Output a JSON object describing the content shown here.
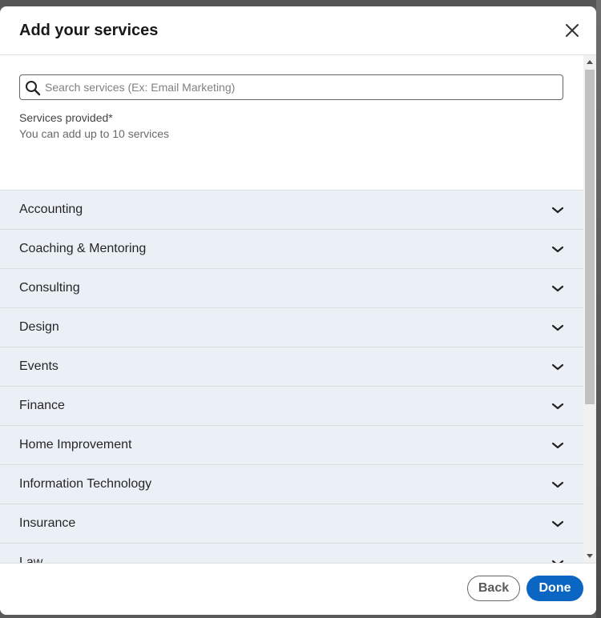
{
  "modal": {
    "title": "Add your services",
    "close_icon": "close-icon"
  },
  "search": {
    "placeholder": "Search services (Ex: Email Marketing)",
    "value": "",
    "icon": "search-icon"
  },
  "services": {
    "label": "Services provided*",
    "hint": "You can add up to 10 services"
  },
  "categories": [
    {
      "label": "Accounting"
    },
    {
      "label": "Coaching & Mentoring"
    },
    {
      "label": "Consulting"
    },
    {
      "label": "Design"
    },
    {
      "label": "Events"
    },
    {
      "label": "Finance"
    },
    {
      "label": "Home Improvement"
    },
    {
      "label": "Information Technology"
    },
    {
      "label": "Insurance"
    },
    {
      "label": "Law"
    }
  ],
  "footer": {
    "back_label": "Back",
    "done_label": "Done"
  },
  "colors": {
    "primary": "#0a66c2",
    "category_bg": "#ebf0f7"
  }
}
